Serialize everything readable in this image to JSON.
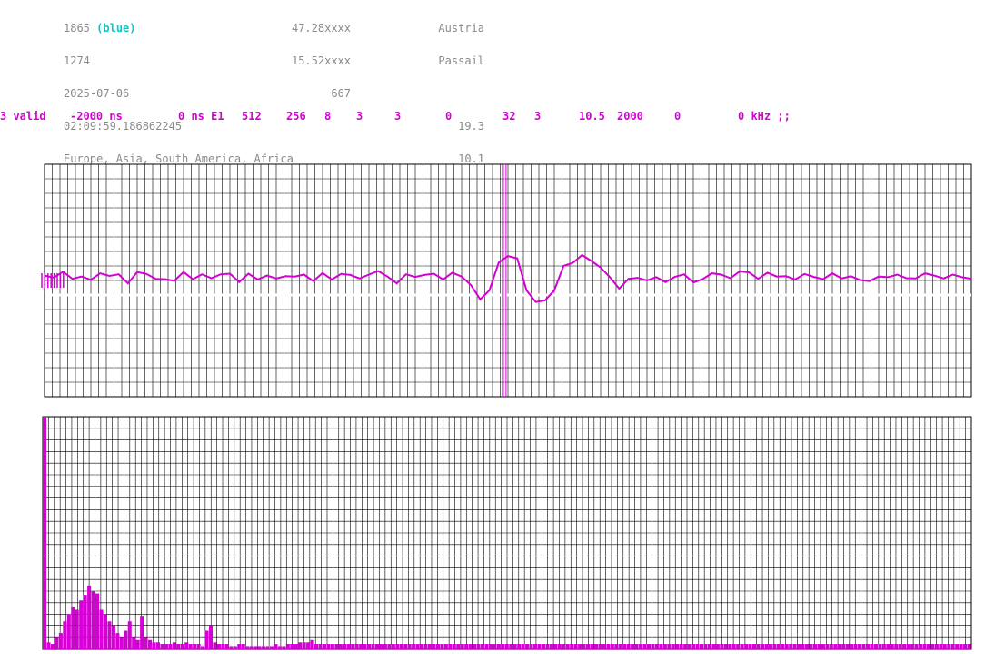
{
  "header": {
    "id_number": "1865",
    "id_color_label": "(blue)",
    "second_number": "1274",
    "date": "2025-07-06",
    "time": "02:09:59.186862245",
    "regions": "Europe, Asia, South America, Africa",
    "latitude": "47.28xxxx",
    "longitude": "15.52xxxx",
    "altitude": "667",
    "country": "Austria",
    "place": "Passail",
    "value_a": "19.3",
    "value_b": "10.1"
  },
  "status_bar": [
    "3 valid",
    "-2000 ns",
    "0 ns E1",
    "512",
    "256",
    "8",
    "3",
    "3",
    "0",
    "32",
    "3",
    "10.5",
    "2000",
    "0",
    "0 kHz ;;"
  ],
  "colors": {
    "trace": "#d400d4",
    "grid": "#000000",
    "info_text": "#8a8a8a",
    "highlight": "#00cccc"
  },
  "chart_data": [
    {
      "type": "line",
      "title": "",
      "grid": true,
      "marker_x": 0.495,
      "baseline_y": 0.5,
      "x": [
        0,
        0.01,
        0.02,
        0.03,
        0.04,
        0.05,
        0.06,
        0.07,
        0.08,
        0.09,
        0.1,
        0.11,
        0.12,
        0.13,
        0.14,
        0.15,
        0.16,
        0.17,
        0.18,
        0.19,
        0.2,
        0.21,
        0.22,
        0.23,
        0.24,
        0.25,
        0.26,
        0.27,
        0.28,
        0.29,
        0.3,
        0.31,
        0.32,
        0.33,
        0.34,
        0.35,
        0.36,
        0.37,
        0.38,
        0.39,
        0.4,
        0.41,
        0.42,
        0.43,
        0.44,
        0.45,
        0.46,
        0.47,
        0.48,
        0.49,
        0.5,
        0.51,
        0.52,
        0.53,
        0.54,
        0.55,
        0.56,
        0.57,
        0.58,
        0.59,
        0.6,
        0.61,
        0.62,
        0.63,
        0.64,
        0.65,
        0.66,
        0.67,
        0.68,
        0.69,
        0.7,
        0.71,
        0.72,
        0.73,
        0.74,
        0.75,
        0.76,
        0.77,
        0.78,
        0.79,
        0.8,
        0.81,
        0.82,
        0.83,
        0.84,
        0.85,
        0.86,
        0.87,
        0.88,
        0.89,
        0.9,
        0.91,
        0.92,
        0.93,
        0.94,
        0.95,
        0.96,
        0.97,
        0.98,
        0.99,
        1.0
      ],
      "values": [
        0.15,
        0.09,
        0.27,
        0.05,
        0.12,
        0.02,
        0.22,
        0.14,
        0.19,
        -0.09,
        0.26,
        0.2,
        0.05,
        0.04,
        -0.01,
        0.26,
        0.04,
        0.19,
        0.07,
        0.19,
        0.21,
        -0.05,
        0.21,
        0.03,
        0.15,
        0.06,
        0.13,
        0.12,
        0.18,
        -0.02,
        0.23,
        0.03,
        0.2,
        0.17,
        0.06,
        0.18,
        0.29,
        0.12,
        -0.09,
        0.19,
        0.11,
        0.17,
        0.21,
        0.03,
        0.24,
        0.12,
        -0.14,
        -0.58,
        -0.3,
        0.55,
        0.75,
        0.68,
        -0.3,
        -0.66,
        -0.61,
        -0.3,
        0.45,
        0.54,
        0.78,
        0.6,
        0.4,
        0.1,
        -0.25,
        0.05,
        0.08,
        0.0,
        0.1,
        -0.05,
        0.11,
        0.19,
        -0.06,
        0.04,
        0.22,
        0.18,
        0.07,
        0.28,
        0.25,
        0.05,
        0.24,
        0.12,
        0.13,
        0.03,
        0.2,
        0.11,
        0.04,
        0.22,
        0.06,
        0.13,
        0.01,
        -0.02,
        0.12,
        0.1,
        0.18,
        0.07,
        0.06,
        0.22,
        0.15,
        0.06,
        0.18,
        0.1,
        0.05
      ]
    },
    {
      "type": "bar",
      "title": "",
      "grid": true,
      "ylim": [
        0,
        1
      ],
      "values": [
        1.0,
        0.03,
        0.02,
        0.05,
        0.07,
        0.12,
        0.15,
        0.18,
        0.17,
        0.21,
        0.23,
        0.27,
        0.25,
        0.24,
        0.17,
        0.15,
        0.12,
        0.1,
        0.07,
        0.05,
        0.08,
        0.12,
        0.05,
        0.04,
        0.14,
        0.05,
        0.04,
        0.03,
        0.03,
        0.02,
        0.02,
        0.02,
        0.03,
        0.02,
        0.02,
        0.03,
        0.02,
        0.02,
        0.02,
        0.01,
        0.08,
        0.1,
        0.03,
        0.02,
        0.02,
        0.02,
        0.01,
        0.01,
        0.02,
        0.02,
        0.01,
        0.01,
        0.01,
        0.01,
        0.01,
        0.01,
        0.01,
        0.02,
        0.01,
        0.01,
        0.02,
        0.02,
        0.02,
        0.03,
        0.03,
        0.03,
        0.04,
        0.02,
        0.02,
        0.02,
        0.02,
        0.02,
        0.02,
        0.02,
        0.02,
        0.02,
        0.02,
        0.02,
        0.02,
        0.02,
        0.02,
        0.02,
        0.02,
        0.02,
        0.02,
        0.02,
        0.02,
        0.02,
        0.02,
        0.02,
        0.02,
        0.02,
        0.02,
        0.02,
        0.02,
        0.02,
        0.02,
        0.02,
        0.02,
        0.02,
        0.02,
        0.02,
        0.02,
        0.02,
        0.02,
        0.02,
        0.02,
        0.02,
        0.02,
        0.02,
        0.02,
        0.02,
        0.02,
        0.02,
        0.02,
        0.02,
        0.02,
        0.02,
        0.02,
        0.02,
        0.02,
        0.02,
        0.02,
        0.02,
        0.02,
        0.02,
        0.02,
        0.02,
        0.02,
        0.02,
        0.02,
        0.02,
        0.02,
        0.02,
        0.02,
        0.02,
        0.02,
        0.02,
        0.02,
        0.02,
        0.02,
        0.02,
        0.02,
        0.02,
        0.02,
        0.02,
        0.02,
        0.02,
        0.02,
        0.02,
        0.02,
        0.02,
        0.02,
        0.02,
        0.02,
        0.02,
        0.02,
        0.02,
        0.02,
        0.02,
        0.02,
        0.02,
        0.02,
        0.02,
        0.02,
        0.02,
        0.02,
        0.02,
        0.02,
        0.02,
        0.02,
        0.02,
        0.02,
        0.02,
        0.02,
        0.02,
        0.02,
        0.02,
        0.02,
        0.02,
        0.02,
        0.02,
        0.02,
        0.02,
        0.02,
        0.02,
        0.02,
        0.02,
        0.02,
        0.02,
        0.02,
        0.02,
        0.02,
        0.02,
        0.02,
        0.02,
        0.02,
        0.02,
        0.02,
        0.02,
        0.02,
        0.02,
        0.02,
        0.02,
        0.02,
        0.02,
        0.02,
        0.02,
        0.02,
        0.02,
        0.02,
        0.02,
        0.02,
        0.02,
        0.02,
        0.02,
        0.02,
        0.02,
        0.02,
        0.02,
        0.02,
        0.02,
        0.02,
        0.02,
        0.02,
        0.02,
        0.02,
        0.02,
        0.02
      ]
    }
  ]
}
